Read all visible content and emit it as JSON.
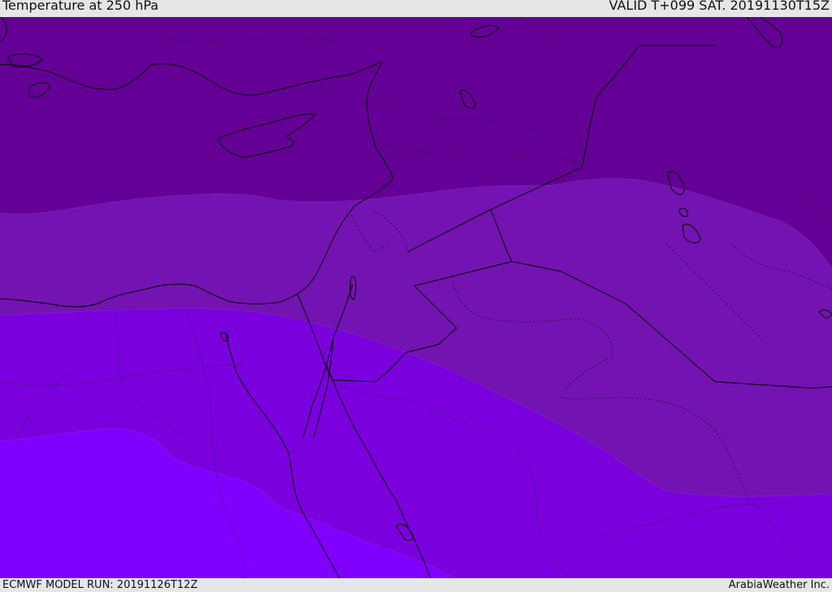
{
  "header": {
    "title": "Temperature at 250 hPa",
    "valid_time": "VALID T+099 SAT. 20191130T15Z"
  },
  "footer": {
    "model_run": "ECMWF MODEL RUN: 20191126T12Z",
    "credit": "ArabiaWeather Inc."
  },
  "colors": {
    "band_coldest": "#640096",
    "band_cold": "#7313b1",
    "band_mid": "#7a00dd",
    "band_warm": "#7f00ff",
    "coastline": "#000000",
    "border": "#000000"
  }
}
